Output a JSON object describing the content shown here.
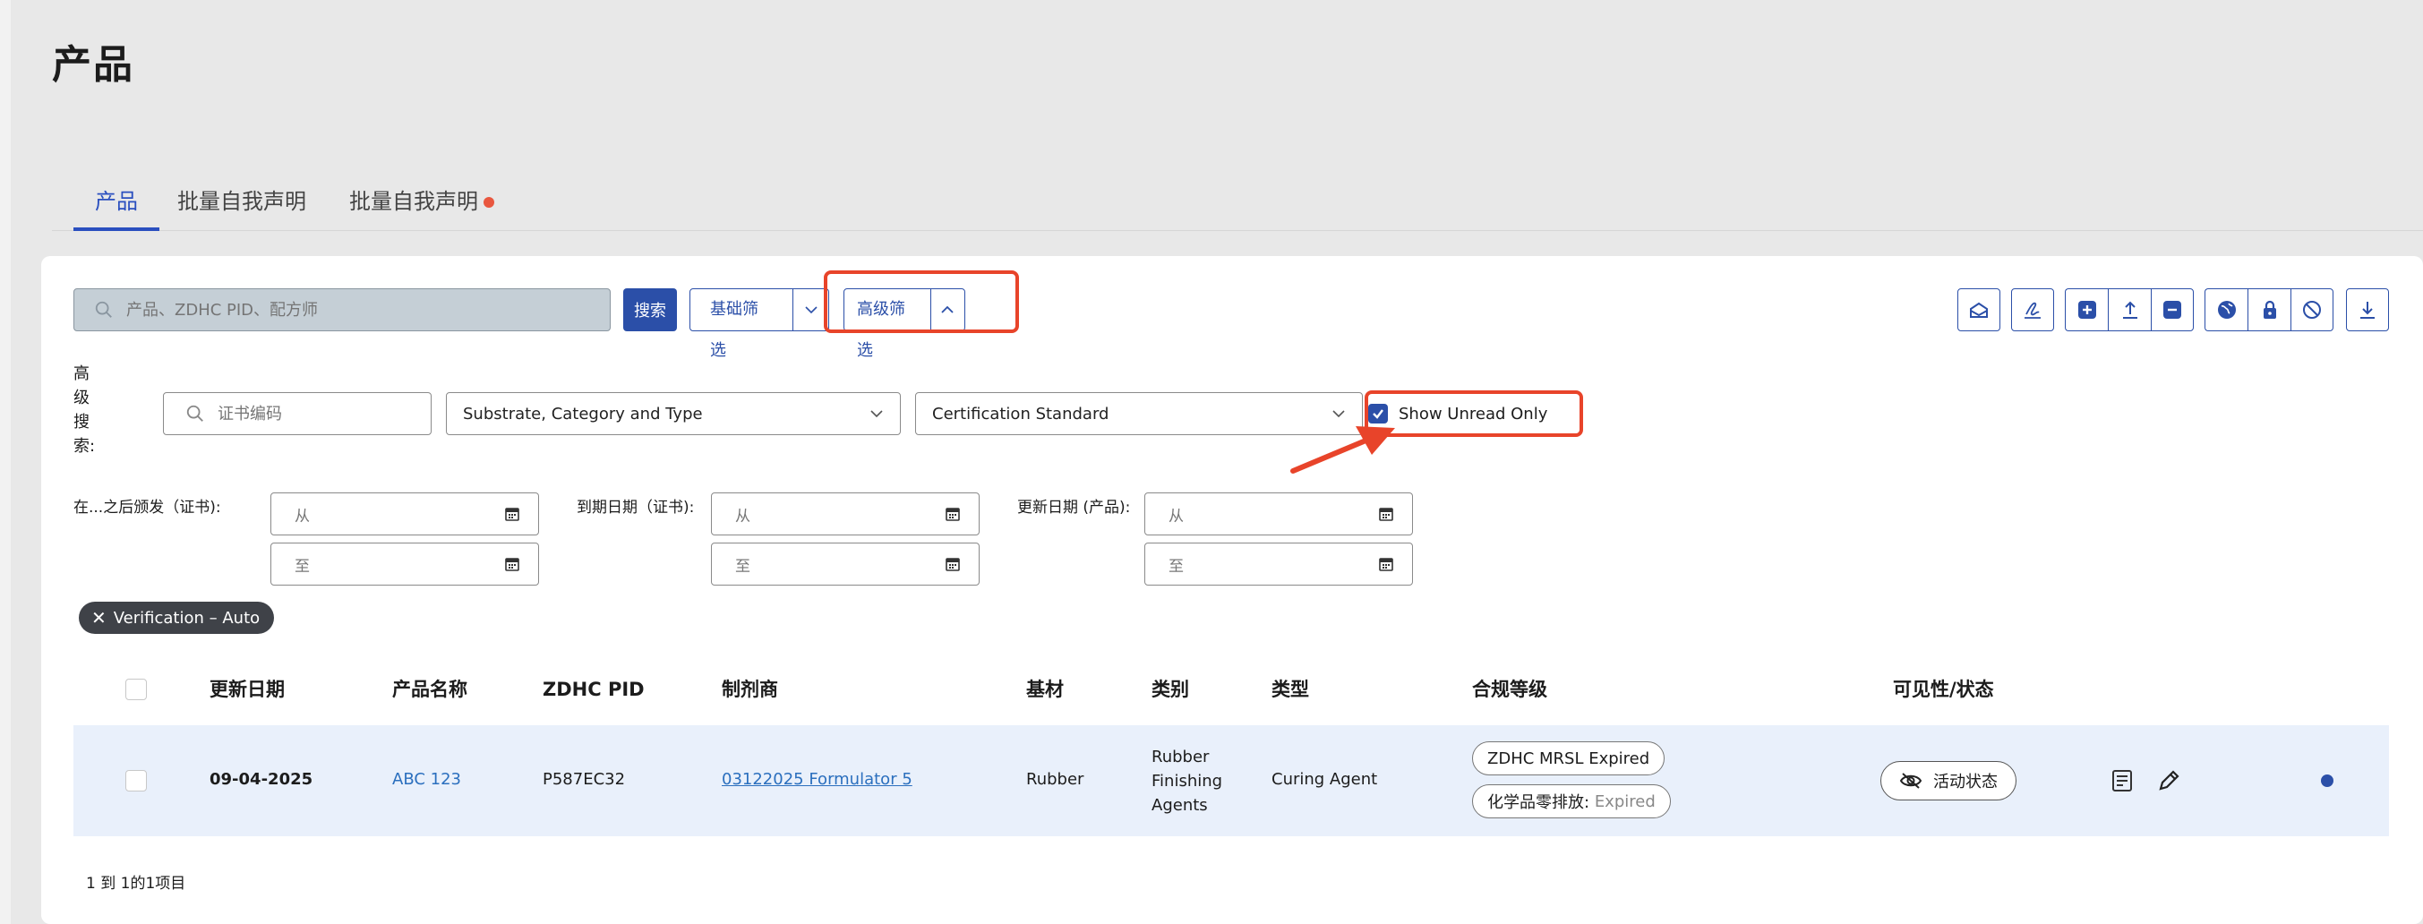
{
  "page": {
    "title": "产品"
  },
  "tabs": [
    {
      "label": "产品",
      "active": true
    },
    {
      "label": "批量自我声明",
      "active": false
    },
    {
      "label": "批量自我声明",
      "active": false,
      "has_dot": true
    }
  ],
  "toolbar": {
    "search_placeholder": "产品、ZDHC PID、配方师",
    "search_button": "搜索",
    "basic_filter": "基础筛选",
    "advanced_filter": "高级筛选",
    "action_icons": [
      "inbox-icon",
      "signature-icon",
      "plus-square-icon",
      "upload-icon",
      "minus-square-icon",
      "globe-icon",
      "lock-icon",
      "block-icon",
      "download-icon"
    ]
  },
  "advanced": {
    "label": "高级搜索:",
    "cert_placeholder": "证书编码",
    "substrate_dropdown": "Substrate, Category and Type",
    "certification_dropdown": "Certification Standard",
    "show_unread_label": "Show Unread Only",
    "show_unread_checked": true,
    "issued_after_label": "在...之后颁发（证书):",
    "expiry_label": "到期日期（证书):",
    "updated_label": "更新日期 (产品):",
    "from_placeholder": "从",
    "to_placeholder": "至"
  },
  "active_filter_chip": "Verification – Auto",
  "table": {
    "headers": [
      "更新日期",
      "产品名称",
      "ZDHC PID",
      "制剂商",
      "基材",
      "类别",
      "类型",
      "合规等级",
      "可见性/状态"
    ],
    "rows": [
      {
        "updated": "09-04-2025",
        "product_name": "ABC 123",
        "zdhc_pid": "P587EC32",
        "formulator": "03122025 Formulator 5",
        "substrate": "Rubber",
        "category_lines": [
          "Rubber",
          "Finishing",
          "Agents"
        ],
        "type": "Curing Agent",
        "compliance": {
          "mrsl": "ZDHC MRSL Expired",
          "zero_discharge_prefix": "化学品零排放:",
          "zero_discharge_status": "Expired"
        },
        "status": "活动状态"
      }
    ]
  },
  "footer": {
    "pagination": "1 到 1的1项目"
  },
  "colors": {
    "accent": "#2b4fa8",
    "highlight": "#e8442a",
    "row_bg": "#e9f0fb"
  }
}
